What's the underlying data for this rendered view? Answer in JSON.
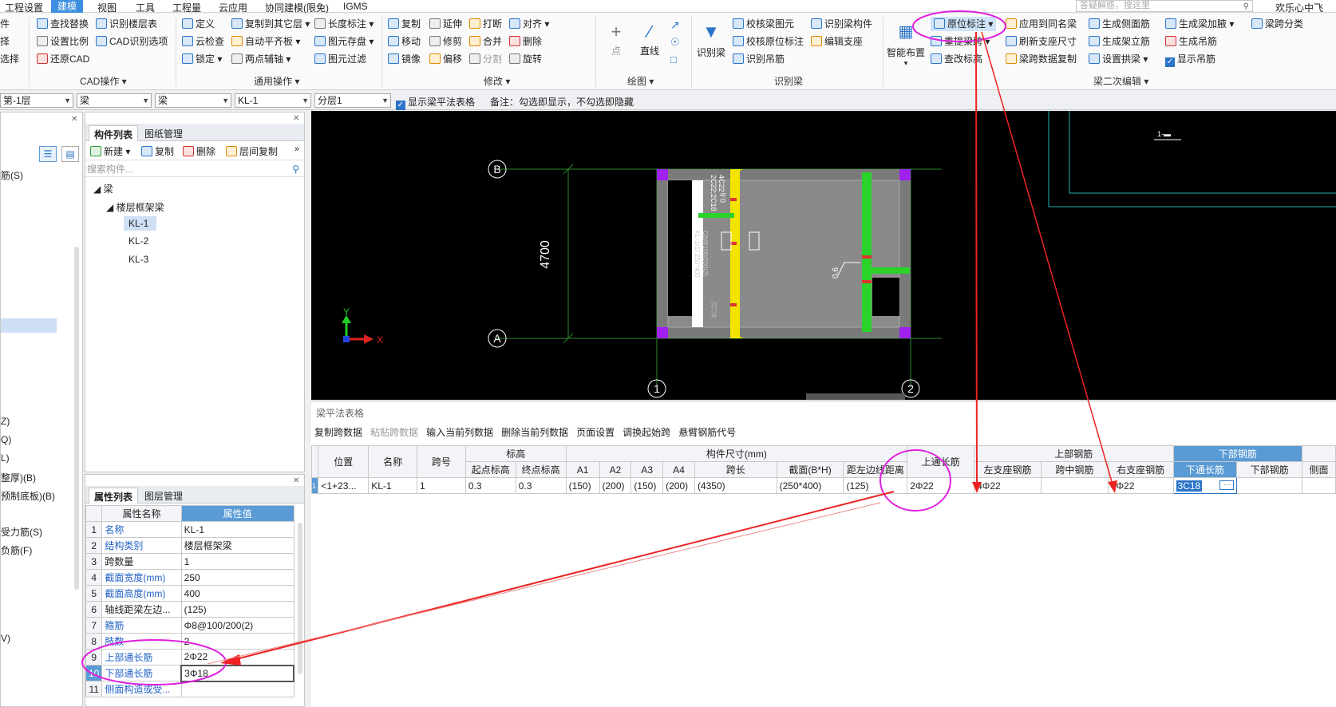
{
  "menu": {
    "tabs": [
      "工程设置",
      "建模",
      "视图",
      "工具",
      "工程量",
      "云应用",
      "协同建模(限免)",
      "IGMS"
    ],
    "active_tab": "建模",
    "search_placeholder": "答疑解惑，搜这里",
    "user": "欢乐心中飞"
  },
  "ribbon": {
    "left_partial": [
      "件",
      "择",
      "选择"
    ],
    "cad": {
      "items": [
        "查找替换",
        "识别楼层表",
        "设置比例",
        "CAD识别选项",
        "还原CAD"
      ],
      "group": "CAD操作"
    },
    "general": {
      "items": [
        "定义",
        "复制到其它层",
        "长度标注",
        "云检查",
        "自动平齐板",
        "图元存盘",
        "锁定",
        "两点辅轴",
        "图元过滤"
      ],
      "group": "通用操作"
    },
    "modify": {
      "items": [
        "复制",
        "延伸",
        "打断",
        "对齐",
        "移动",
        "修剪",
        "合并",
        "删除",
        "镜像",
        "偏移",
        "分割",
        "旋转"
      ],
      "group": "修改"
    },
    "draw": {
      "items": [
        "点",
        "直线"
      ],
      "group": "绘图"
    },
    "recognize": {
      "big": "识别梁",
      "items": [
        "校核梁图元",
        "识别梁构件",
        "校核原位标注",
        "编辑支座",
        "识别吊筋"
      ],
      "group": "识别梁"
    },
    "beam2": {
      "big": "智能布置",
      "items": [
        "原位标注",
        "应用到同名梁",
        "生成侧面筋",
        "生成梁加腋",
        "梁跨分类",
        "重提梁跨",
        "刷新支座尺寸",
        "生成架立筋",
        "生成吊筋",
        "查改标高",
        "梁跨数据复制",
        "设置拱梁",
        "显示吊筋"
      ],
      "group": "梁二次编辑"
    }
  },
  "filterbar": {
    "floor": "第-1层",
    "type1": "梁",
    "type2": "梁",
    "component": "KL-1",
    "layer": "分层1",
    "show_table_label": "显示梁平法表格",
    "note": "备注：勾选即显示，不勾选即隐藏"
  },
  "left_strip": [
    "筋(S)",
    "Z)",
    "Q)",
    "L)",
    "整厚)(B)",
    "预制底板)(B)",
    "受力筋(S)",
    "负筋(F)",
    "V)"
  ],
  "component_panel": {
    "tabs": [
      "构件列表",
      "图纸管理"
    ],
    "toolbar": [
      "新建",
      "复制",
      "删除",
      "层间复制"
    ],
    "search_placeholder": "搜索构件...",
    "tree": {
      "root": "梁",
      "group": "楼层框架梁",
      "items": [
        "KL-1",
        "KL-2",
        "KL-3"
      ]
    },
    "selected": "KL-1"
  },
  "property_panel": {
    "tabs": [
      "属性列表",
      "图层管理"
    ],
    "headers": [
      "属性名称",
      "属性值"
    ],
    "rows": [
      {
        "n": "1",
        "name": "名称",
        "value": "KL-1"
      },
      {
        "n": "2",
        "name": "结构类别",
        "value": "楼层框架梁"
      },
      {
        "n": "3",
        "name": "跨数量",
        "value": "1"
      },
      {
        "n": "4",
        "name": "截面宽度(mm)",
        "value": "250"
      },
      {
        "n": "5",
        "name": "截面高度(mm)",
        "value": "400"
      },
      {
        "n": "6",
        "name": "轴线距梁左边...",
        "value": "(125)"
      },
      {
        "n": "7",
        "name": "箍筋",
        "value": "Φ8@100/200(2)"
      },
      {
        "n": "8",
        "name": "肢数",
        "value": "2"
      },
      {
        "n": "9",
        "name": "上部通长筋",
        "value": "2Φ22"
      },
      {
        "n": "10",
        "name": "下部通长筋",
        "value": "3Φ18"
      },
      {
        "n": "11",
        "name": "侧面构造或受...",
        "value": ""
      }
    ]
  },
  "canvas": {
    "axis_labels": {
      "b": "B",
      "a": "A",
      "n1": "1",
      "n2": "2"
    },
    "dimension": "4700",
    "beam_texts": [
      "2C22;2C18",
      "4C22",
      "C8@100/200(2)",
      "KL-1(1) 250*400",
      "0.6",
      "4C22",
      "0.6"
    ],
    "coord_x": "X",
    "coord_y": "Y",
    "top_right_label": "1-▬"
  },
  "bottom": {
    "title": "梁平法表格",
    "toolbar": [
      "复制跨数据",
      "粘贴跨数据",
      "输入当前列数据",
      "删除当前列数据",
      "页面设置",
      "调换起始跨",
      "悬臂钢筋代号"
    ],
    "toolbar_disabled": [
      false,
      true,
      false,
      false,
      false,
      false,
      false
    ],
    "headers_top": {
      "elevation": "标高",
      "size": "构件尺寸(mm)",
      "top_bars": "上部钢筋",
      "bottom_bars": "下部钢筋"
    },
    "headers": [
      "位置",
      "名称",
      "跨号",
      "起点标高",
      "终点标高",
      "A1",
      "A2",
      "A3",
      "A4",
      "跨长",
      "截面(B*H)",
      "距左边线距离",
      "上通长筋",
      "左支座钢筋",
      "跨中钢筋",
      "右支座钢筋",
      "下通长筋",
      "下部钢筋",
      "侧面"
    ],
    "row": [
      "1",
      "<1+23...",
      "KL-1",
      "1",
      "0.3",
      "0.3",
      "(150)",
      "(200)",
      "(150)",
      "(200)",
      "(4350)",
      "(250*400)",
      "(125)",
      "2Φ22",
      "4Φ22",
      "",
      "4Φ22",
      "3C18",
      ""
    ]
  }
}
